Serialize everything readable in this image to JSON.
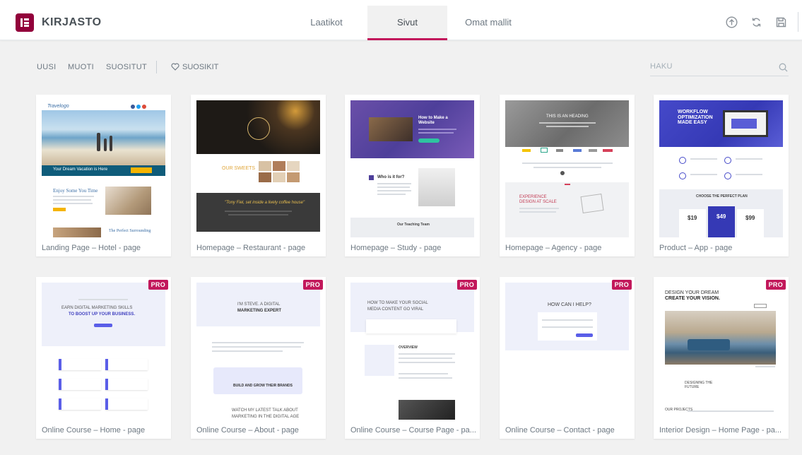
{
  "header": {
    "brand": "KIRJASTO",
    "tabs": [
      {
        "label": "Laatikot"
      },
      {
        "label": "Sivut"
      },
      {
        "label": "Omat mallit"
      }
    ],
    "active_tab": "Sivut",
    "icons": [
      "upload-icon",
      "sync-icon",
      "save-icon"
    ]
  },
  "filters": {
    "items": [
      {
        "label": "UUSI"
      },
      {
        "label": "MUOTI"
      },
      {
        "label": "SUOSITUT"
      }
    ],
    "favorites": "SUOSIKIT",
    "search_placeholder": "HAKU"
  },
  "badge_label": "PRO",
  "templates": [
    {
      "title": "Landing Page – Hotel - page",
      "pro": false
    },
    {
      "title": "Homepage – Restaurant - page",
      "pro": false
    },
    {
      "title": "Homepage – Study - page",
      "pro": false
    },
    {
      "title": "Homepage – Agency - page",
      "pro": false
    },
    {
      "title": "Product – App - page",
      "pro": false
    },
    {
      "title": "Online Course – Home - page",
      "pro": true
    },
    {
      "title": "Online Course – About - page",
      "pro": true
    },
    {
      "title": "Online Course – Course Page - pa...",
      "pro": true
    },
    {
      "title": "Online Course – Contact - page",
      "pro": true
    },
    {
      "title": "Interior Design – Home Page - pa...",
      "pro": true
    }
  ],
  "thumbnails": {
    "hotel": {
      "logo": "Travelogo",
      "banner": "Your Dream Vacation is Here",
      "h1": "Enjoy Some You Time",
      "h2": "The Perfect Surrounding"
    },
    "restaurant": {
      "title": "OUR SWEETS",
      "quote": "\"Tony Fiel, set inside a lively coffee house\""
    },
    "study": {
      "hero": "How to Make a Website",
      "who": "Who is it for?",
      "team": "Our Teaching Team"
    },
    "agency": {
      "hero": "THIS IS AN HEADING",
      "section": "EXPERIENCE DESIGN AT SCALE"
    },
    "app": {
      "hero": "WORKFLOW OPTIMIZATION MADE EASY",
      "plan": "CHOOSE THE PERFECT PLAN",
      "prices": [
        "$19",
        "$49",
        "$99"
      ]
    },
    "course_home": {
      "hero_a": "EARN DIGITAL MARKETING SKILLS",
      "hero_b": "TO BOOST UP YOUR BUSINESS."
    },
    "course_about": {
      "hero_a": "I'M STEVE. A DIGITAL",
      "hero_b": "MARKETING EXPERT",
      "mission": "BUILD AND GROW THEIR BRANDS",
      "talk_a": "WATCH MY LATEST TALK ABOUT",
      "talk_b": "MARKETING IN THE DIGITAL AGE"
    },
    "course_page": {
      "hero_a": "HOW TO MAKE YOUR SOCIAL",
      "hero_b": "MEDIA CONTENT GO VIRAL",
      "overview": "OVERVIEW"
    },
    "course_contact": {
      "hero": "HOW CAN I HELP?"
    },
    "interior": {
      "hero_a": "DESIGN YOUR DREAM",
      "hero_b": "CREATE YOUR VISION.",
      "designing": "DESIGNING THE FUTURE",
      "projects": "OUR PROJECTS"
    }
  },
  "colors": {
    "brand": "#92003b",
    "accent": "#c2185b"
  }
}
